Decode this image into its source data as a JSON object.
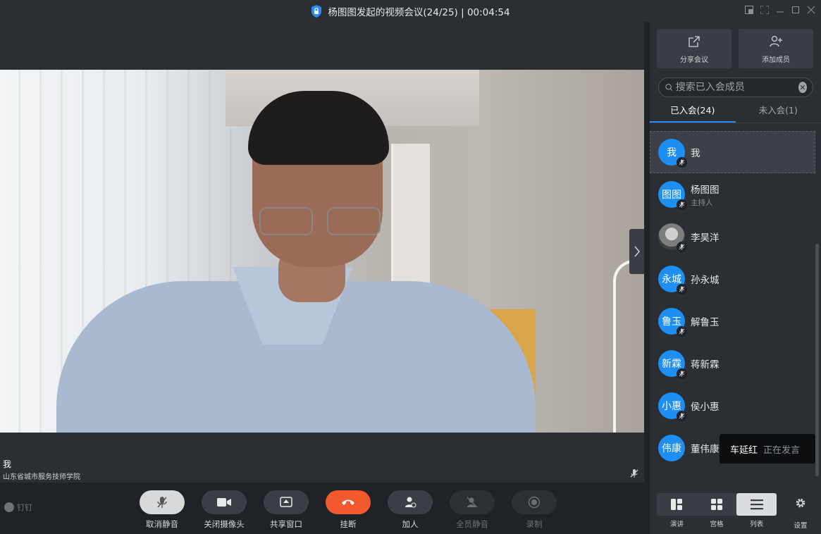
{
  "window": {
    "title": "杨图图发起的视频会议(24/25) | 00:04:54"
  },
  "stage": {
    "self_name": "我",
    "self_org": "山东省城市服务技师学院"
  },
  "toolbar": {
    "brand": "钉钉",
    "buttons": [
      {
        "label": "取消静音",
        "icon": "mic-off-icon"
      },
      {
        "label": "关闭摄像头",
        "icon": "camera-icon"
      },
      {
        "label": "共享窗口",
        "icon": "share-screen-icon"
      },
      {
        "label": "挂断",
        "icon": "hangup-icon"
      },
      {
        "label": "加人",
        "icon": "add-person-icon"
      },
      {
        "label": "全员静音",
        "icon": "mute-all-icon"
      },
      {
        "label": "录制",
        "icon": "record-icon"
      }
    ]
  },
  "panel": {
    "share_label": "分享会议",
    "add_member_label": "添加成员",
    "search_placeholder": "搜索已入会成员",
    "tabs": [
      {
        "label": "已入会(24)",
        "active": true
      },
      {
        "label": "未入会(1)",
        "active": false
      }
    ],
    "members": [
      {
        "avatar": "我",
        "name": "我",
        "role": ""
      },
      {
        "avatar": "图图",
        "name": "杨图图",
        "role": "主持人"
      },
      {
        "avatar": "",
        "name": "李昊洋",
        "role": ""
      },
      {
        "avatar": "永城",
        "name": "孙永城",
        "role": ""
      },
      {
        "avatar": "鲁玉",
        "name": "解鲁玉",
        "role": ""
      },
      {
        "avatar": "新霖",
        "name": "蒋新霖",
        "role": ""
      },
      {
        "avatar": "小惠",
        "name": "侯小惠",
        "role": ""
      },
      {
        "avatar": "伟康",
        "name": "董伟康",
        "role": ""
      }
    ],
    "speaking_toast": {
      "name": "车延红",
      "status": "正在发言"
    },
    "views": [
      {
        "label": "演讲",
        "icon": "speaker-layout-icon"
      },
      {
        "label": "宫格",
        "icon": "grid-layout-icon"
      },
      {
        "label": "列表",
        "icon": "list-layout-icon",
        "active": true
      }
    ],
    "settings_label": "设置"
  },
  "colors": {
    "accent": "#2a8cf4",
    "hangup": "#f25a2e",
    "avatar": "#1d8ef2"
  }
}
